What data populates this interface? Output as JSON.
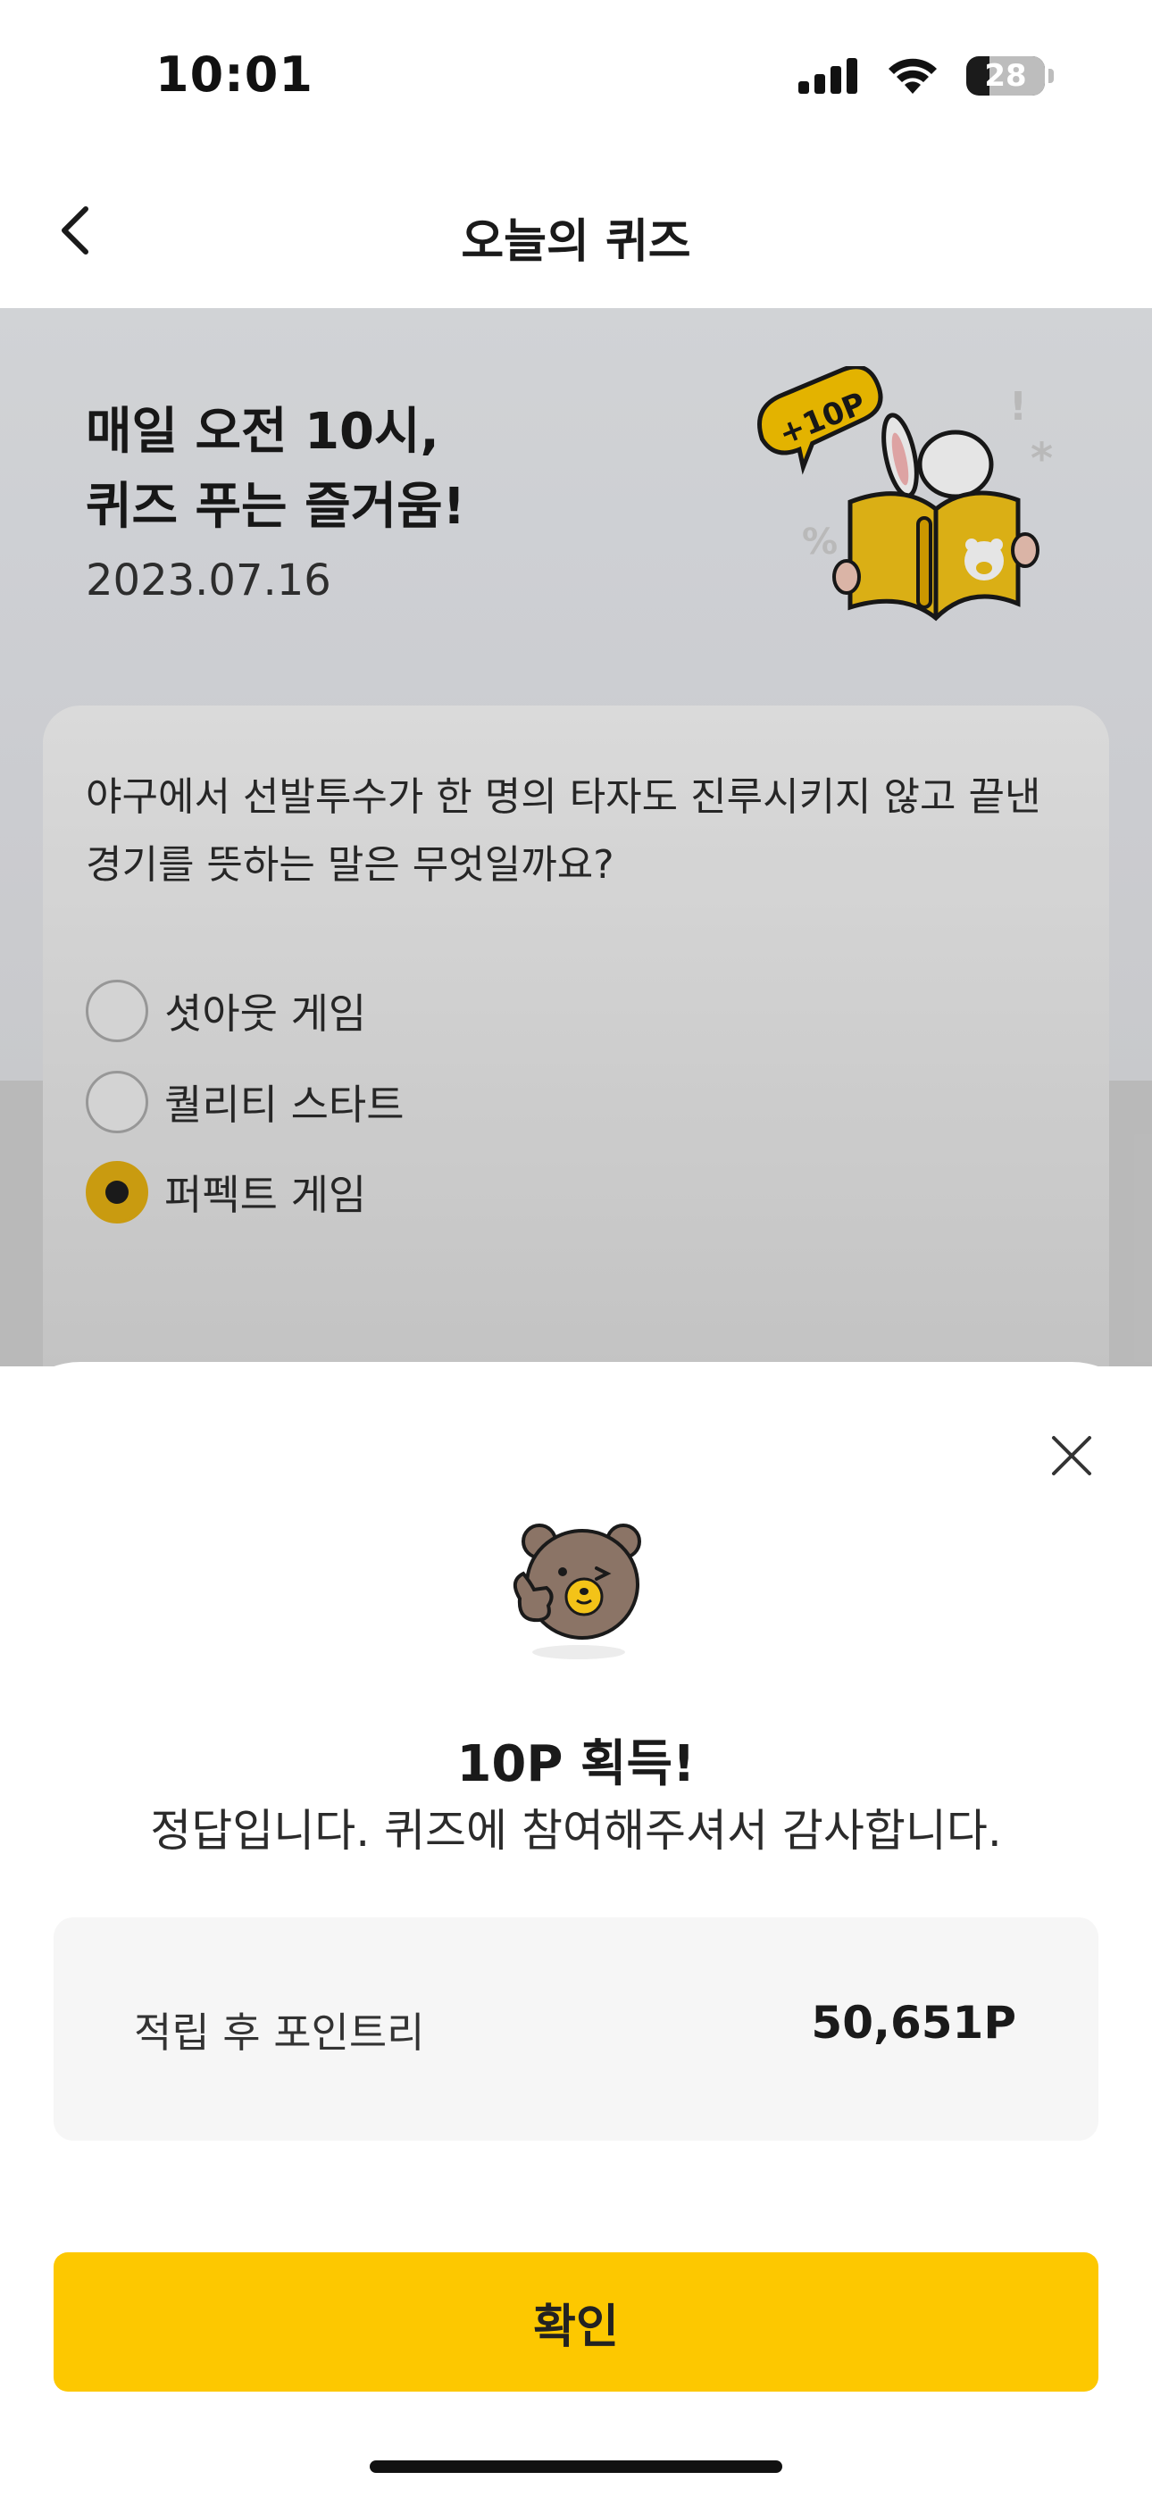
{
  "status_bar": {
    "time": "10:01",
    "battery_level": "28",
    "icons": [
      "cellular-signal-icon",
      "wifi-icon",
      "battery-icon"
    ]
  },
  "nav": {
    "title": "오늘의 퀴즈",
    "back_icon": "chevron-left-icon"
  },
  "hero": {
    "title_line1": "매일 오전 10시,",
    "title_line2": "퀴즈 푸는 즐거움!",
    "date": "2023.07.16",
    "badge": "+10P"
  },
  "quiz": {
    "question_line1": "야구에서 선발투수가 한 명의 타자도 진루시키지 않고 끝낸",
    "question_line2": "경기를 뜻하는 말은 무엇일까요?",
    "options": [
      {
        "label": "셧아웃 게임",
        "selected": false
      },
      {
        "label": "퀄리티 스타트",
        "selected": false
      },
      {
        "label": "퍼펙트 게임",
        "selected": true
      }
    ]
  },
  "result_sheet": {
    "earned": "10P 획득!",
    "message": "정답입니다. 퀴즈에 참여해주셔서 감사합니다.",
    "points_label": "적립 후 포인트리",
    "points_value": "50,651P",
    "confirm_label": "확인",
    "close_icon": "close-icon"
  },
  "colors": {
    "accent_yellow": "#fdc800",
    "radio_selected": "#e0ad12",
    "hero_bg": "#e9ebef"
  }
}
